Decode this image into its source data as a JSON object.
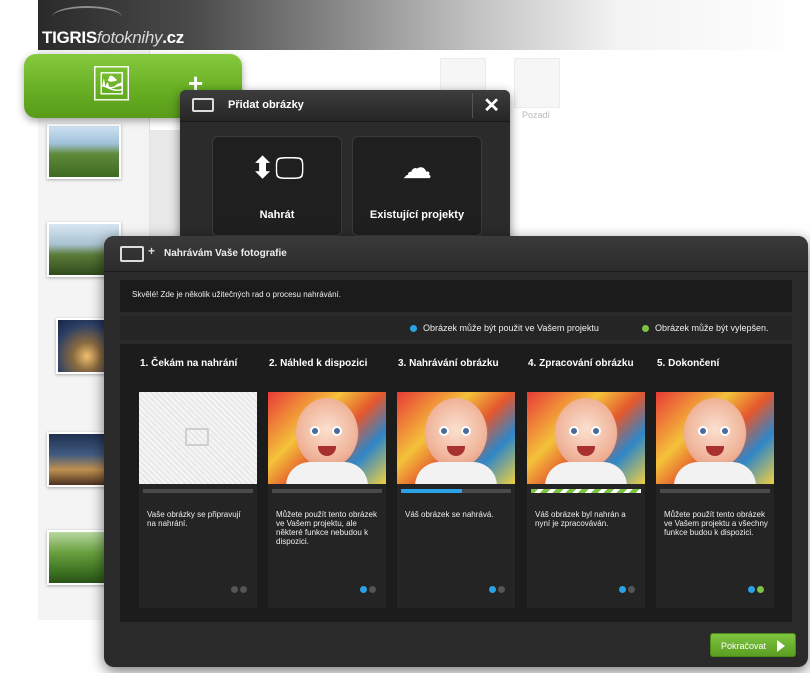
{
  "brand": {
    "logo_bold": "TIGRIS",
    "logo_italic": "fotoknihy",
    "logo_suffix": ".cz"
  },
  "background": {
    "ghost_label": "Pozadí"
  },
  "add_photos_dialog": {
    "title": "Přidat obrázky",
    "close": "✕",
    "options": [
      {
        "label": "Nahrát",
        "icon": "upload-monitor-icon"
      },
      {
        "label": "Existující projekty",
        "icon": "cloud-download-icon"
      }
    ]
  },
  "upload_dialog": {
    "title": "Nahrávám Vaše fotografie",
    "tips": "Skvělé! Zde je několik užitečných rad o procesu nahrávání.",
    "legend": [
      {
        "label": "Obrázek může být použit ve Vašem projektu",
        "color": "#2aa2e6"
      },
      {
        "label": "Obrázek může být vylepšen.",
        "color": "#7cc243"
      }
    ],
    "steps": [
      {
        "title": "1. Čekám na nahrání",
        "text": "Vaše obrázky se připravují na nahrání.",
        "progress": 0
      },
      {
        "title": "2. Náhled k dispozici",
        "text": "Můžete použít tento obrázek ve Vašem projektu, ale některé funkce nebudou k dispozici.",
        "progress": 0
      },
      {
        "title": "3. Nahrávání obrázku",
        "text": "Váš obrázek se nahrává.",
        "progress": 0.55
      },
      {
        "title": "4. Zpracování obrázku",
        "text": "Váš obrázek byl nahrán a nyní je zpracováván.",
        "progress": 1
      },
      {
        "title": "5. Dokončení",
        "text": "Můžete použít tento obrázek ve Vašem projektu a všechny funkce budou k dispozici.",
        "progress": 1
      }
    ],
    "continue_label": "Pokračovat"
  },
  "colors": {
    "accent_green": "#66ad22",
    "accent_blue": "#2aa2e6"
  }
}
